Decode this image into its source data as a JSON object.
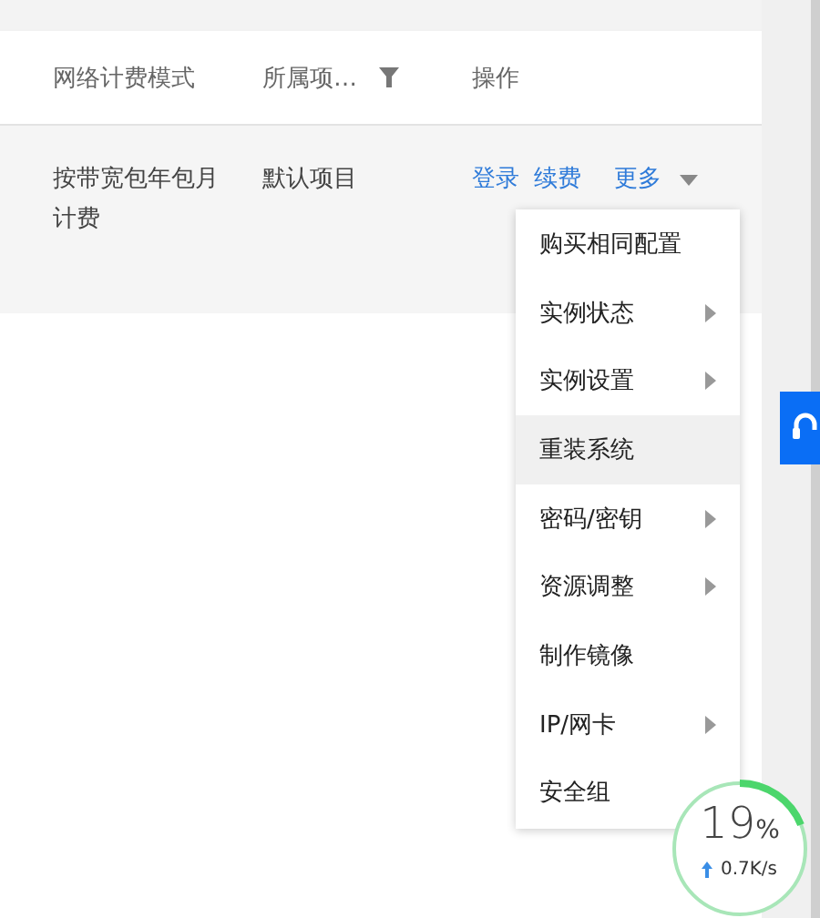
{
  "table": {
    "columns": [
      {
        "label": "网络计费模式",
        "filter": false
      },
      {
        "label": "所属项…",
        "filter": true
      },
      {
        "label": "操作",
        "filter": false
      }
    ],
    "rows": [
      {
        "billing": "按带宽包年包月计费",
        "project": "默认项目",
        "actions": [
          {
            "label": "登录",
            "kind": "link"
          },
          {
            "label": "续费",
            "kind": "link"
          },
          {
            "label": "更多",
            "kind": "dropdown"
          }
        ]
      }
    ]
  },
  "dropdown_menu": {
    "items": [
      {
        "label": "购买相同配置",
        "submenu": false,
        "selected": false
      },
      {
        "label": "实例状态",
        "submenu": true,
        "selected": false
      },
      {
        "label": "实例设置",
        "submenu": true,
        "selected": false
      },
      {
        "label": "重装系统",
        "submenu": false,
        "selected": true
      },
      {
        "label": "密码/密钥",
        "submenu": true,
        "selected": false
      },
      {
        "label": "资源调整",
        "submenu": true,
        "selected": false
      },
      {
        "label": "制作镜像",
        "submenu": false,
        "selected": false
      },
      {
        "label": "IP/网卡",
        "submenu": true,
        "selected": false
      },
      {
        "label": "安全组",
        "submenu": false,
        "selected": false
      }
    ]
  },
  "speed_widget": {
    "percent": "19",
    "unit": "%",
    "speed": "0.7K/s",
    "level": 0.19
  }
}
